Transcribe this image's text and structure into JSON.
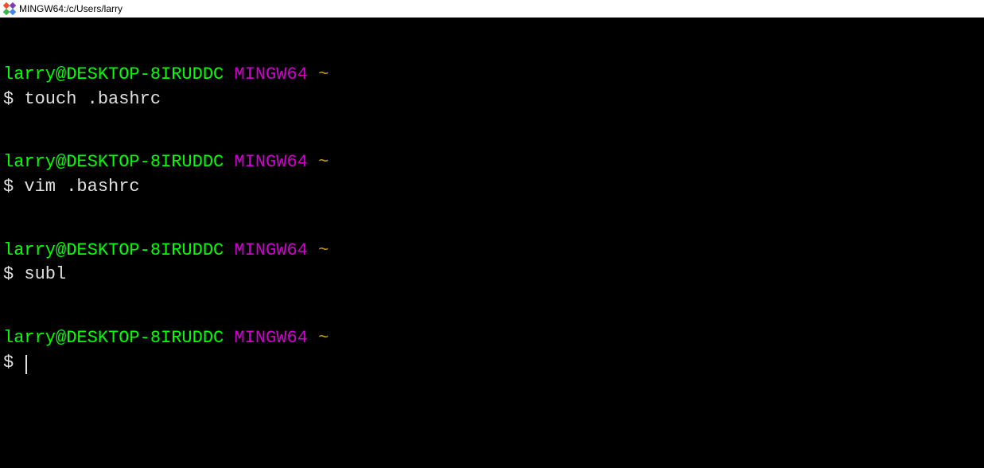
{
  "window": {
    "title": "MINGW64:/c/Users/larry"
  },
  "prompt": {
    "user_host": "larry@DESKTOP-8IRUDDC",
    "env": "MINGW64",
    "path": "~",
    "symbol": "$"
  },
  "entries": [
    {
      "command": "touch .bashrc"
    },
    {
      "command": "vim .bashrc"
    },
    {
      "command": "subl"
    },
    {
      "command": ""
    }
  ]
}
